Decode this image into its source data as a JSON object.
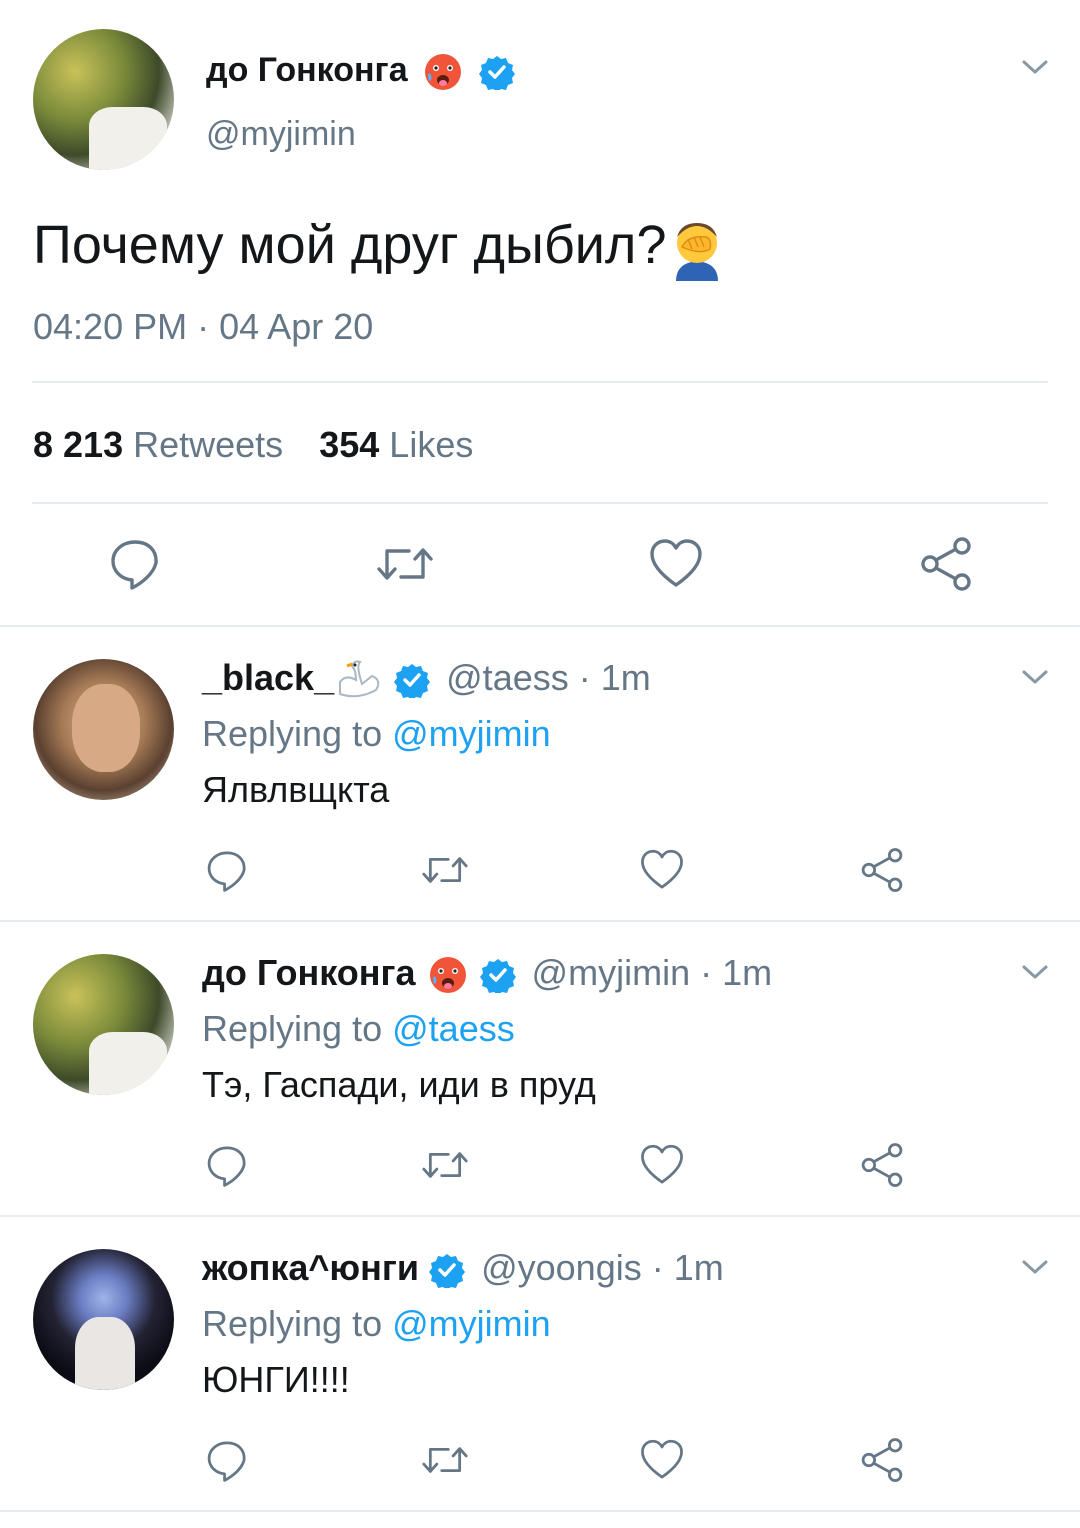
{
  "main_tweet": {
    "display_name": "до Гонконга",
    "handle": "@myjimin",
    "text": "Почему мой друг дыбил?",
    "time": "04:20 PM",
    "date_separator": "·",
    "date": "04 Apr 20",
    "retweets_count": "8 213",
    "retweets_label": "Retweets",
    "likes_count": "354",
    "likes_label": "Likes"
  },
  "replies": [
    {
      "display_name": "_black_",
      "handle": "@taess",
      "time": "· 1m",
      "replying_prefix": "Replying to",
      "replying_to": "@myjimin",
      "text": "Ялвлвщкта"
    },
    {
      "display_name": "до Гонконга",
      "handle": "@myjimin",
      "time": "· 1m",
      "replying_prefix": "Replying to",
      "replying_to": "@taess",
      "text": "Тэ, Гаспади, иди в пруд"
    },
    {
      "display_name": "жопка^юнги",
      "handle": "@yoongis",
      "time": "· 1m",
      "replying_prefix": "Replying to",
      "replying_to": "@myjimin",
      "text": "ЮНГИ!!!!"
    }
  ],
  "icons": [
    "chevron-down-icon",
    "verified-badge-icon",
    "hot-face-emoji",
    "facepalm-emoji",
    "swan-emoji",
    "reply-icon",
    "retweet-icon",
    "like-icon",
    "share-icon"
  ],
  "colors": {
    "verified": "#1da1f2",
    "link": "#1da1f2",
    "muted": "#657786",
    "text": "#14171a",
    "divider": "#e6ecf0"
  }
}
